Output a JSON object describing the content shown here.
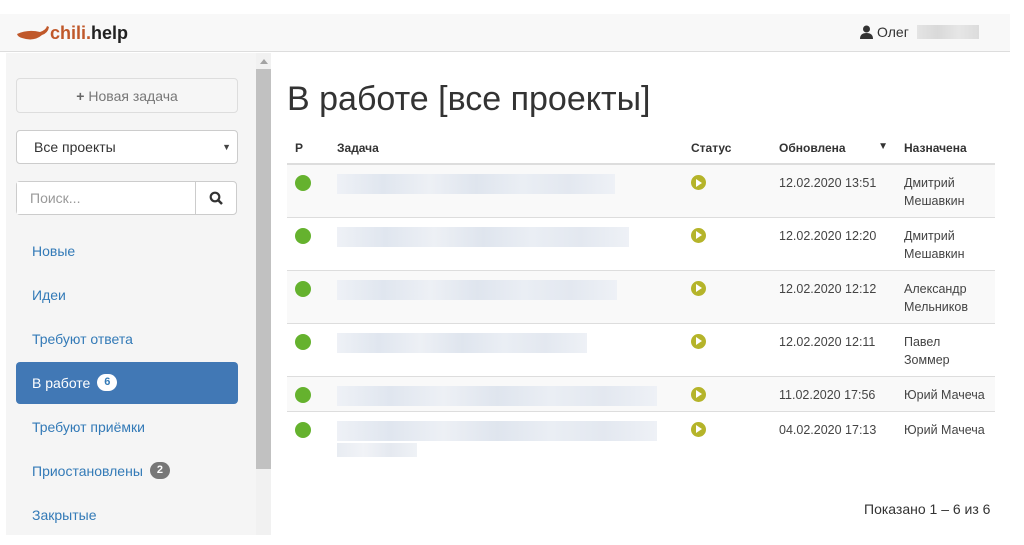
{
  "header": {
    "logo_a": "chili.",
    "logo_b": "help",
    "user": "Олег"
  },
  "sidebar": {
    "new_task": "Новая задача",
    "project_select": "Все проекты",
    "search_placeholder": "Поиск...",
    "items": [
      {
        "label": "Новые"
      },
      {
        "label": "Идеи"
      },
      {
        "label": "Требуют ответа"
      },
      {
        "label": "В работе",
        "badge": "6",
        "active": true
      },
      {
        "label": "Требуют приёмки"
      },
      {
        "label": "Приостановлены",
        "badge": "2"
      },
      {
        "label": "Закрытые"
      }
    ]
  },
  "main": {
    "title": "В работе [все проекты]",
    "columns": {
      "p": "Р",
      "task": "Задача",
      "status": "Статус",
      "updated": "Обновлена",
      "assigned": "Назначена"
    },
    "rows": [
      {
        "updated": "12.02.2020 13:51",
        "assigned": "Дмитрий Мешавкин"
      },
      {
        "updated": "12.02.2020 12:20",
        "assigned": "Дмитрий Мешавкин"
      },
      {
        "updated": "12.02.2020 12:12",
        "assigned": "Александр Мельников"
      },
      {
        "updated": "12.02.2020 12:11",
        "assigned": "Павел Зоммер"
      },
      {
        "updated": "11.02.2020 17:56",
        "assigned": "Юрий Мачеча"
      },
      {
        "updated": "04.02.2020 17:13",
        "assigned": "Юрий Мачеча"
      }
    ],
    "footer": "Показано 1 – 6 из 6"
  },
  "colors": {
    "accent": "#4178b5",
    "priority": "#65b22e",
    "status": "#b5b42a"
  }
}
